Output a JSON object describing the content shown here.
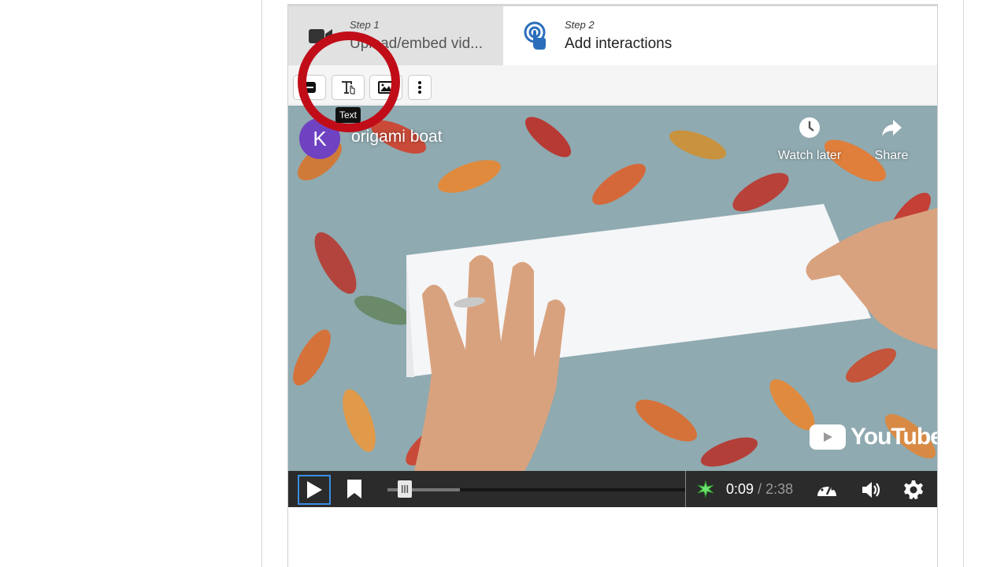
{
  "steps": [
    {
      "small": "Step 1",
      "label": "Upload/embed vid..."
    },
    {
      "small": "Step 2",
      "label": "Add interactions"
    }
  ],
  "toolbar": {
    "tooltip": "Text",
    "buttons": [
      "statement-icon",
      "text-icon",
      "image-icon",
      "more-icon"
    ]
  },
  "video": {
    "channel_initial": "K",
    "title": "origami boat",
    "watch_later": "Watch later",
    "share": "Share",
    "logo_text": "YouTube",
    "current_time": "0:09",
    "separator": "/",
    "duration": "2:38",
    "progress_fraction": 0.057
  },
  "colors": {
    "accent_blue": "#2a6ebb",
    "annotation_red": "#c00d18",
    "avatar_purple": "#6f42c1"
  }
}
